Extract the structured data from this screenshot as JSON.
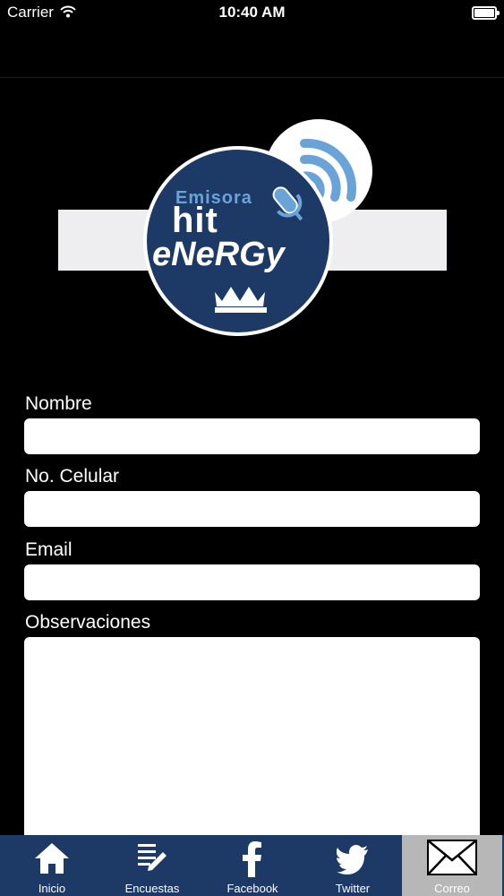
{
  "status_bar": {
    "carrier": "Carrier",
    "time": "10:40 AM"
  },
  "logo": {
    "line1": "Emisora",
    "line2": "hit",
    "line3": "eNeRGy"
  },
  "form": {
    "nombre_label": "Nombre",
    "celular_label": "No. Celular",
    "email_label": "Email",
    "observaciones_label": "Observaciones",
    "nombre_value": "",
    "celular_value": "",
    "email_value": "",
    "observaciones_value": ""
  },
  "tabs": [
    {
      "label": "Inicio",
      "icon": "home-icon"
    },
    {
      "label": "Encuestas",
      "icon": "survey-icon"
    },
    {
      "label": "Facebook",
      "icon": "facebook-icon"
    },
    {
      "label": "Twitter",
      "icon": "twitter-icon"
    },
    {
      "label": "Correo",
      "icon": "mail-icon",
      "active": true
    }
  ],
  "colors": {
    "tab_bar": "#1d3a66",
    "active_tab": "#b7b7b7",
    "logo_accent": "#6aa3d8"
  }
}
